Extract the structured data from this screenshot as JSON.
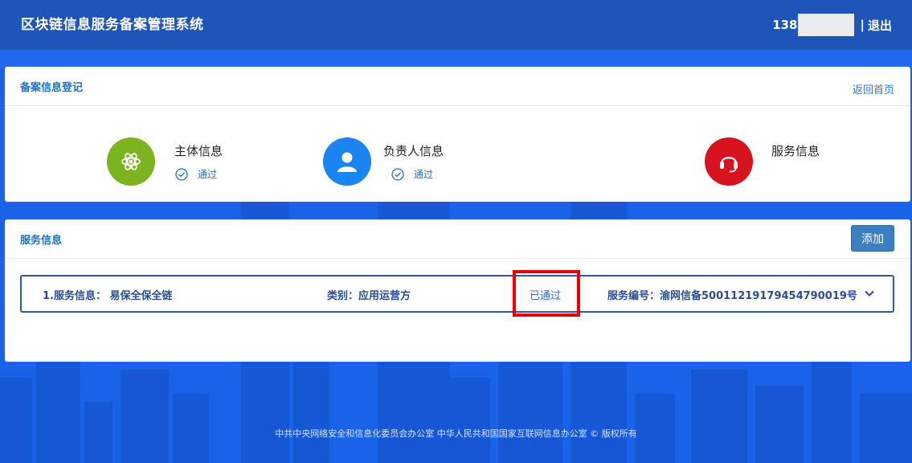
{
  "header": {
    "title": "区块链信息服务备案管理系统",
    "user_phone": "138",
    "separator": "|",
    "logout_label": "退出"
  },
  "filing_card": {
    "title": "备案信息登记",
    "back_home_label": "返回首页",
    "steps": [
      {
        "label": "主体信息",
        "status": "通过",
        "color": "#7cb320",
        "icon": "atom-icon"
      },
      {
        "label": "负责人信息",
        "status": "通过",
        "color": "#1a84f0",
        "icon": "person-icon"
      },
      {
        "label": "服务信息",
        "status": "",
        "color": "#d6121f",
        "icon": "headset-icon"
      }
    ]
  },
  "service_card": {
    "title": "服务信息",
    "add_label": "添加",
    "rows": [
      {
        "name": "1.服务信息：  易保全保全链",
        "category": "类别：应用运营方",
        "status": "已通过",
        "service_no": "服务编号：渝网信备50011219179454790019号"
      }
    ]
  },
  "footer": {
    "text": "中共中央网络安全和信息化委员会办公室   中华人民共和国国家互联网信息办公室 © 版权所有"
  },
  "colors": {
    "topbar": "#1f55b8",
    "background": "#1a63e8",
    "accent": "#1a70c8",
    "highlight": "#ee0000"
  }
}
